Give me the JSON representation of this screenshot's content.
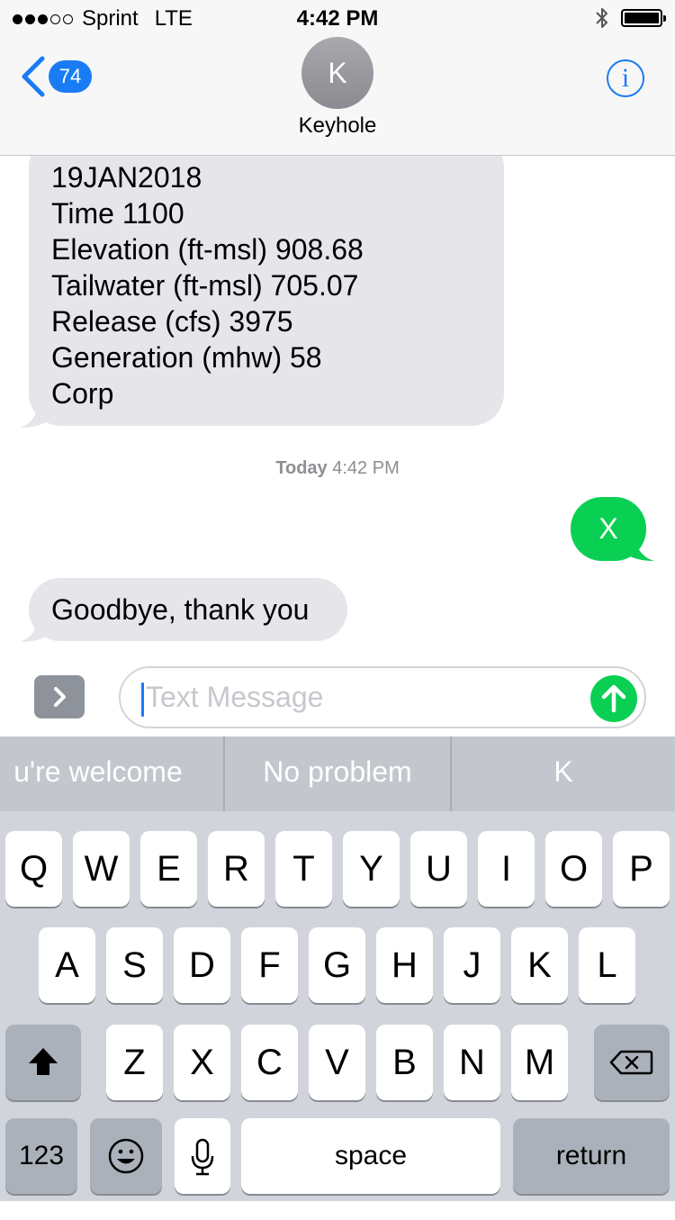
{
  "status_bar": {
    "carrier": "Sprint",
    "network": "LTE",
    "time": "4:42 PM"
  },
  "header": {
    "back_count": "74",
    "avatar_initial": "K",
    "contact_name": "Keyhole",
    "info_glyph": "i"
  },
  "messages": {
    "long_incoming": [
      "19JAN2018",
      "Time 1100",
      "Elevation (ft-msl) 908.68",
      "Tailwater (ft-msl) 705.07",
      "Release (cfs) 3975",
      "Generation (mhw) 58",
      "Corp"
    ],
    "timestamp_day": "Today",
    "timestamp_time": "4:42 PM",
    "outgoing": "X",
    "incoming": "Goodbye, thank you"
  },
  "composer": {
    "placeholder": "Text Message"
  },
  "predictive": [
    "u're welcome",
    "No problem",
    "K"
  ],
  "keyboard": {
    "row1": [
      "Q",
      "W",
      "E",
      "R",
      "T",
      "Y",
      "U",
      "I",
      "O",
      "P"
    ],
    "row2": [
      "A",
      "S",
      "D",
      "F",
      "G",
      "H",
      "J",
      "K",
      "L"
    ],
    "row3": [
      "Z",
      "X",
      "C",
      "V",
      "B",
      "N",
      "M"
    ],
    "numbers_label": "123",
    "space_label": "space",
    "return_label": "return"
  },
  "colors": {
    "blue": "#1a7cf5",
    "green": "#09d053",
    "incoming_bubble": "#e5e5ea",
    "keyboard_bg": "#d1d5db"
  },
  "icons": [
    "back-chevron-icon",
    "info-icon",
    "bluetooth-icon",
    "battery-icon",
    "apps-chevron-icon",
    "send-arrow-icon",
    "shift-icon",
    "backspace-icon",
    "emoji-icon",
    "microphone-icon"
  ]
}
